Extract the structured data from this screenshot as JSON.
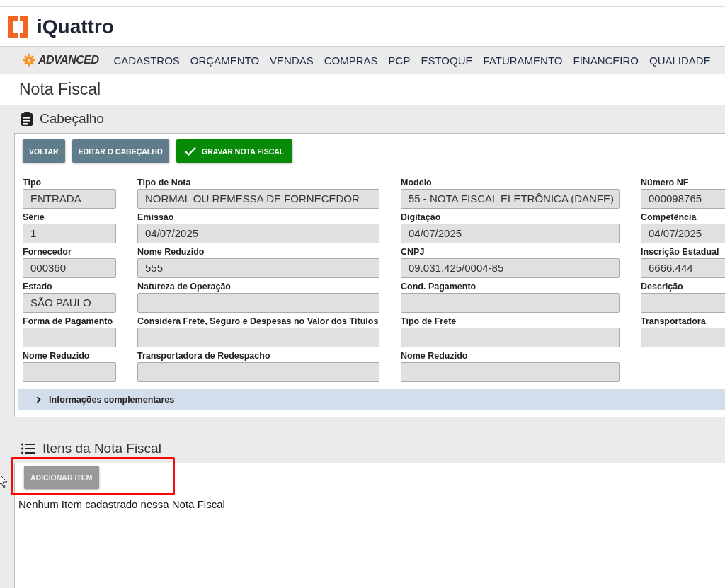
{
  "brand": {
    "logo_text": "iQuattro"
  },
  "nav": {
    "badge": "ADVANCED",
    "items": [
      "CADASTROS",
      "ORÇAMENTO",
      "VENDAS",
      "COMPRAS",
      "PCP",
      "ESTOQUE",
      "FATURAMENTO",
      "FINANCEIRO",
      "QUALIDADE"
    ]
  },
  "page_title": "Nota Fiscal",
  "header_section": {
    "title": "Cabeçalho",
    "buttons": [
      {
        "label": "VOLTAR",
        "kind": "secondary"
      },
      {
        "label": "EDITAR O CABEÇALHO",
        "kind": "secondary"
      },
      {
        "label": "GRAVAR NOTA FISCAL",
        "kind": "primary"
      }
    ],
    "columns": [
      [
        {
          "label": "Tipo",
          "value": "ENTRADA"
        },
        {
          "label": "Série",
          "value": "1"
        },
        {
          "label": "Fornecedor",
          "value": "000360"
        },
        {
          "label": "Estado",
          "value": "SÃO PAULO"
        },
        {
          "label": "Forma de Pagamento"
        },
        {
          "label": "Nome Reduzido"
        }
      ],
      [
        {
          "label": "Tipo de Nota",
          "value": "NORMAL OU REMESSA DE FORNECEDOR"
        },
        {
          "label": "Emissão",
          "value": "04/07/2025"
        },
        {
          "label": "Nome Reduzido",
          "value": "555"
        },
        {
          "label": "Natureza de Operação"
        },
        {
          "label": "Considera Frete, Seguro e Despesas no Valor dos Títulos"
        },
        {
          "label": "Transportadora de Redespacho"
        }
      ],
      [
        {
          "label": "Modelo",
          "value": "55 - NOTA FISCAL ELETRÔNICA (DANFE)"
        },
        {
          "label": "Digitação",
          "value": "04/07/2025"
        },
        {
          "label": "CNPJ",
          "value": "09.031.425/0004-85"
        },
        {
          "label": "Cond. Pagamento"
        },
        {
          "label": "Tipo de Frete"
        },
        {
          "label": "Nome Reduzido"
        }
      ],
      [
        {
          "label": "Número NF",
          "value": "000098765"
        },
        {
          "label": "Competência",
          "value": "04/07/2025"
        },
        {
          "label": "Inscrição Estadual",
          "value": "6666.444"
        },
        {
          "label": "Descrição"
        },
        {
          "label": "Transportadora"
        }
      ]
    ],
    "accordion": {
      "label": "Informações complementares",
      "expanded": false
    }
  },
  "items_section": {
    "title": "Itens da Nota Fiscal",
    "add_button": {
      "label": "ADICIONAR ITEM",
      "disabled": true,
      "highlighted": true
    },
    "empty_message": "Nenhum Item cadastrado nessa Nota Fiscal"
  }
}
